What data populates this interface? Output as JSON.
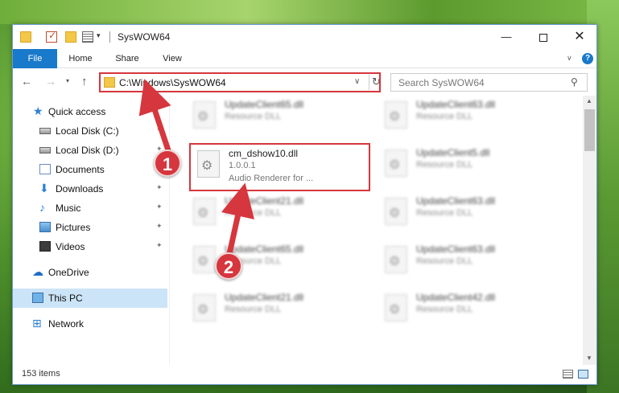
{
  "window": {
    "title": "SysWOW64",
    "minimize_glyph": "—",
    "close_glyph": "✕"
  },
  "ribbon": {
    "tabs": [
      "File",
      "Home",
      "Share",
      "View"
    ]
  },
  "address": {
    "path": "C:\\Windows\\SysWOW64",
    "search_placeholder": "Search SysWOW64"
  },
  "sidebar": {
    "items": [
      {
        "label": "Quick access",
        "icon": "star-icon"
      },
      {
        "label": "Local Disk (C:)",
        "icon": "disk-icon"
      },
      {
        "label": "Local Disk (D:)",
        "icon": "disk-icon"
      },
      {
        "label": "Documents",
        "icon": "document-icon"
      },
      {
        "label": "Downloads",
        "icon": "download-icon"
      },
      {
        "label": "Music",
        "icon": "music-icon"
      },
      {
        "label": "Pictures",
        "icon": "pictures-icon"
      },
      {
        "label": "Videos",
        "icon": "video-icon"
      },
      {
        "label": "OneDrive",
        "icon": "cloud-icon"
      },
      {
        "label": "This PC",
        "icon": "computer-icon"
      },
      {
        "label": "Network",
        "icon": "network-icon"
      }
    ],
    "selected": "This PC"
  },
  "files": {
    "highlighted": {
      "name": "cm_dshow10.dll",
      "version": "1.0.0.1",
      "description": "Audio Renderer for ..."
    },
    "others": [
      {
        "name": "UpdateClient65.dll",
        "type": "Resource DLL"
      },
      {
        "name": "UpdateClient63.dll",
        "type": "Resource DLL"
      },
      {
        "name": "UpdateClient5.dll",
        "type": "Resource DLL"
      },
      {
        "name": "UpdateClient21.dll",
        "type": "Resource DLL"
      },
      {
        "name": "UpdateClient63.dll",
        "type": "Resource DLL"
      },
      {
        "name": "UpdateClient65.dll",
        "type": "Resource DLL"
      },
      {
        "name": "UpdateClient63.dll",
        "type": "Resource DLL"
      },
      {
        "name": "UpdateClient21.dll",
        "type": "Resource DLL"
      },
      {
        "name": "UpdateClient42.dll",
        "type": "Resource DLL"
      }
    ]
  },
  "status": {
    "item_count": "153 items"
  },
  "annotations": {
    "step1": "1",
    "step2": "2",
    "color": "#d6363d"
  }
}
